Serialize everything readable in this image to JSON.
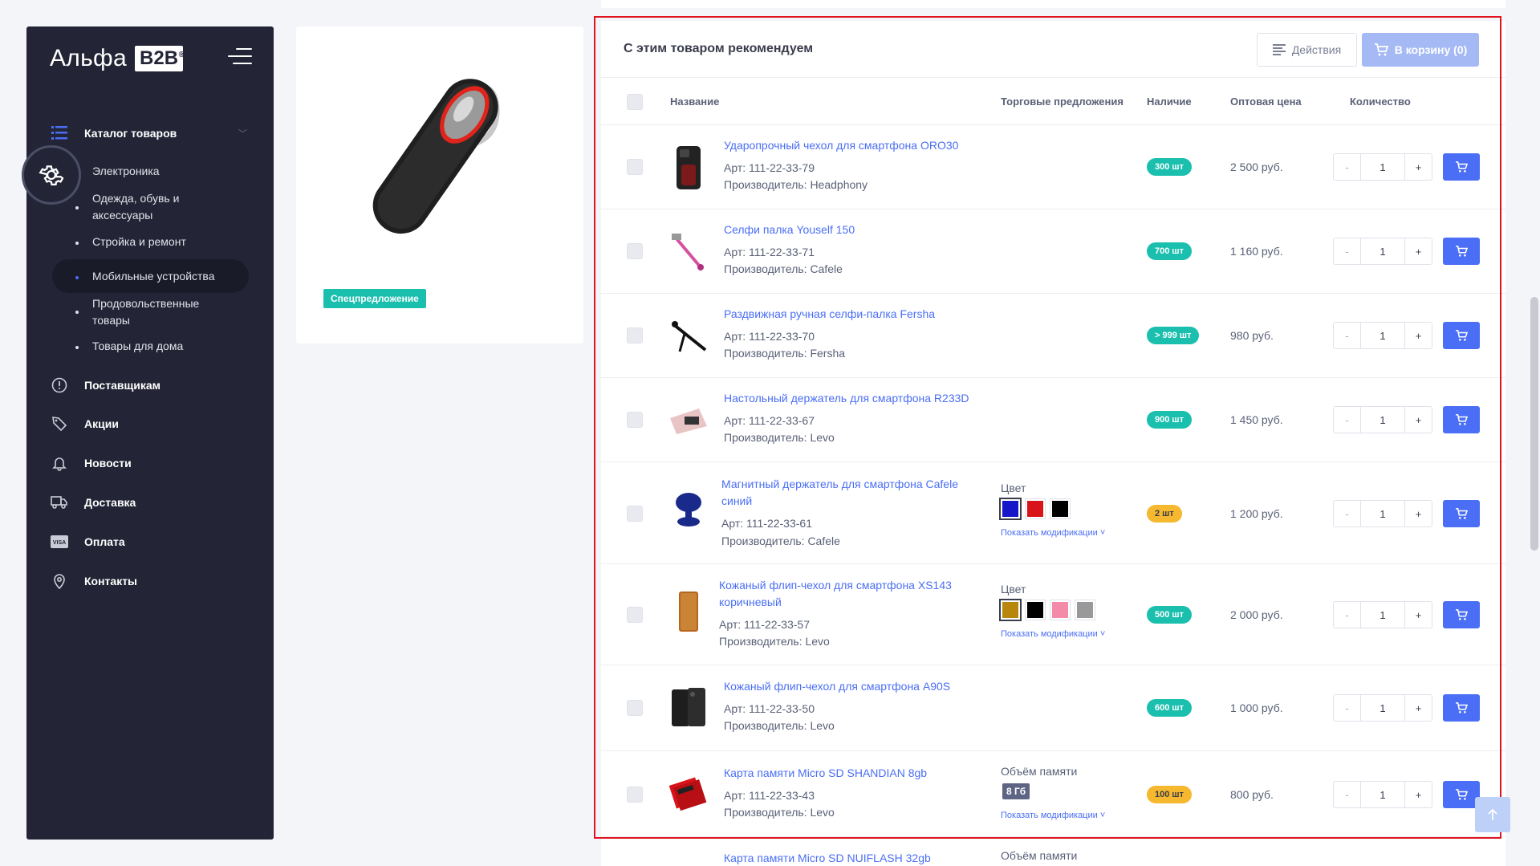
{
  "sidebar": {
    "logo_text": "Альфа",
    "logo_badge": "B2B",
    "catalog_label": "Каталог товаров",
    "catalog_subitems": [
      {
        "label": "Электроника"
      },
      {
        "label": "Одежда, обувь и аксессуары"
      },
      {
        "label": "Стройка и ремонт"
      },
      {
        "label": "Мобильные устройства"
      },
      {
        "label": "Продовольственные товары"
      },
      {
        "label": "Товары для дома"
      }
    ],
    "items": [
      {
        "label": "Поставщикам",
        "icon": "info-icon"
      },
      {
        "label": "Акции",
        "icon": "tag-icon"
      },
      {
        "label": "Новости",
        "icon": "bell-icon"
      },
      {
        "label": "Доставка",
        "icon": "truck-icon"
      },
      {
        "label": "Оплата",
        "icon": "visa-card-icon"
      },
      {
        "label": "Контакты",
        "icon": "map-pin-icon"
      }
    ]
  },
  "product_card": {
    "badge": "Спецпредложение"
  },
  "panel": {
    "title": "С этим товаром рекомендуем",
    "actions_label": "Действия",
    "cart_label": "В корзину (0)",
    "columns": {
      "name": "Название",
      "offers": "Торговые предложения",
      "stock": "Наличие",
      "price": "Оптовая цена",
      "qty": "Количество"
    },
    "show_mods_label": "Показать модификации",
    "rows": [
      {
        "name": "Ударопрочный чехол для смартфона ORO30",
        "sku": "Арт: 111-22-33-79",
        "maker": "Производитель: Headphony",
        "stock": "300 шт",
        "stock_color": "green",
        "price": "2 500 руб.",
        "qty": "1"
      },
      {
        "name": "Селфи палка Youself 150",
        "sku": "Арт: 111-22-33-71",
        "maker": "Производитель: Cafele",
        "stock": "700 шт",
        "stock_color": "green",
        "price": "1 160 руб.",
        "qty": "1"
      },
      {
        "name": "Раздвижная ручная селфи-палка Fersha",
        "sku": "Арт: 111-22-33-70",
        "maker": "Производитель: Fersha",
        "stock": "> 999 шт",
        "stock_color": "green",
        "price": "980 руб.",
        "qty": "1"
      },
      {
        "name": "Настольный держатель для смартфона R233D",
        "sku": "Арт: 111-22-33-67",
        "maker": "Производитель: Levo",
        "stock": "900 шт",
        "stock_color": "green",
        "price": "1 450 руб.",
        "qty": "1"
      },
      {
        "name_line1": "Магнитный держатель для смартфона Cafele",
        "name_line2": "синий",
        "sku": "Арт: 111-22-33-61",
        "maker": "Производитель: Cafele",
        "offer_label": "Цвет",
        "colors": [
          "#1616c8",
          "#d8141a",
          "#000000"
        ],
        "stock": "2 шт",
        "stock_color": "yellow",
        "price": "1 200 руб.",
        "qty": "1"
      },
      {
        "name_line1": "Кожаный флип-чехол для смартфона XS143",
        "name_line2": "коричневый",
        "sku": "Арт: 111-22-33-57",
        "maker": "Производитель: Levo",
        "offer_label": "Цвет",
        "colors": [
          "#b8860b",
          "#000000",
          "#f28aa8",
          "#999999"
        ],
        "stock": "500 шт",
        "stock_color": "green",
        "price": "2 000 руб.",
        "qty": "1"
      },
      {
        "name": "Кожаный флип-чехол для смартфона A90S",
        "sku": "Арт: 111-22-33-50",
        "maker": "Производитель: Levo",
        "stock": "600 шт",
        "stock_color": "green",
        "price": "1 000 руб.",
        "qty": "1"
      },
      {
        "name": "Карта памяти Micro SD SHANDIAN 8gb",
        "sku": "Арт: 111-22-33-43",
        "maker": "Производитель: Levo",
        "offer_label": "Объём памяти",
        "mem": "8 Гб",
        "stock": "100 шт",
        "stock_color": "yellow",
        "price": "800 руб.",
        "qty": "1"
      },
      {
        "name": "Карта памяти Micro SD NUIFLASH 32gb",
        "offer_label": "Объём памяти"
      }
    ]
  },
  "qty_controls": {
    "minus": "-",
    "plus": "+"
  }
}
